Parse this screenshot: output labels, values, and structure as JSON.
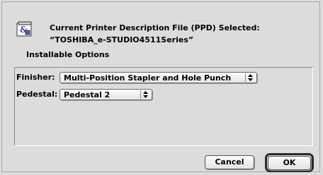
{
  "header": {
    "line1": "Current Printer Description File (PPD) Selected:",
    "line2": "“TOSHIBA_e-STUDIO4511Series”",
    "section_label": "Installable Options",
    "icon": "ppd-document-icon"
  },
  "options": [
    {
      "label": "Finisher:",
      "value": "Multi-Position Stapler and Hole Punch"
    },
    {
      "label": "Pedestal:",
      "value": "Pedestal 2"
    }
  ],
  "buttons": {
    "cancel": "Cancel",
    "ok": "OK"
  }
}
